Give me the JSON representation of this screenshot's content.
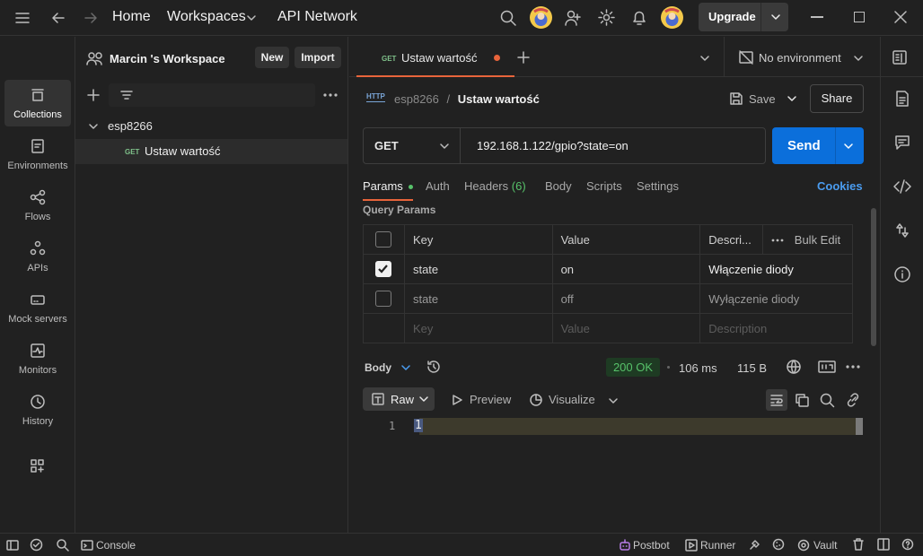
{
  "topbar": {
    "home": "Home",
    "workspaces": "Workspaces",
    "api_network": "API Network",
    "upgrade": "Upgrade"
  },
  "rail": {
    "items": [
      {
        "label": "Collections",
        "icon": "collections-icon"
      },
      {
        "label": "Environments",
        "icon": "environments-icon"
      },
      {
        "label": "Flows",
        "icon": "flows-icon"
      },
      {
        "label": "APIs",
        "icon": "apis-icon"
      },
      {
        "label": "Mock servers",
        "icon": "mock-servers-icon"
      },
      {
        "label": "Monitors",
        "icon": "monitors-icon"
      },
      {
        "label": "History",
        "icon": "history-icon"
      }
    ]
  },
  "sidebar": {
    "workspace_name": "Marcin 's Workspace",
    "new_label": "New",
    "import_label": "Import",
    "collection_name": "esp8266",
    "request_method": "GET",
    "request_name": "Ustaw wartość"
  },
  "tabs": {
    "active_method": "GET",
    "active_title": "Ustaw wartość",
    "environment": "No environment"
  },
  "request": {
    "breadcrumb_collection": "esp8266",
    "breadcrumb_sep": "/",
    "breadcrumb_request": "Ustaw wartość",
    "save_label": "Save",
    "share_label": "Share",
    "method": "GET",
    "url": "192.168.1.122/gpio?state=on",
    "send_label": "Send"
  },
  "subtabs": {
    "params": "Params",
    "auth": "Auth",
    "headers": "Headers",
    "headers_count": "(6)",
    "body": "Body",
    "scripts": "Scripts",
    "settings": "Settings",
    "cookies": "Cookies"
  },
  "params": {
    "section_title": "Query Params",
    "headers": {
      "key": "Key",
      "value": "Value",
      "description": "Descri...",
      "bulk_edit": "Bulk Edit"
    },
    "rows": [
      {
        "checked": true,
        "key": "state",
        "value": "on",
        "description": "Włączenie diody"
      },
      {
        "checked": false,
        "key": "state",
        "value": "off",
        "description": "Wyłączenie diody"
      }
    ],
    "placeholder": {
      "key": "Key",
      "value": "Value",
      "description": "Description"
    }
  },
  "response": {
    "body_label": "Body",
    "status": "200 OK",
    "time": "106 ms",
    "size": "115 B",
    "raw_label": "Raw",
    "preview_label": "Preview",
    "visualize_label": "Visualize",
    "line_number": "1",
    "content": "1"
  },
  "statusbar": {
    "console": "Console",
    "postbot": "Postbot",
    "runner": "Runner",
    "vault": "Vault"
  },
  "colors": {
    "accent": "#0b6fdb",
    "unsaved_dot": "#e8643b",
    "ok_green": "#57c26a",
    "get_green": "#7fc08a"
  }
}
